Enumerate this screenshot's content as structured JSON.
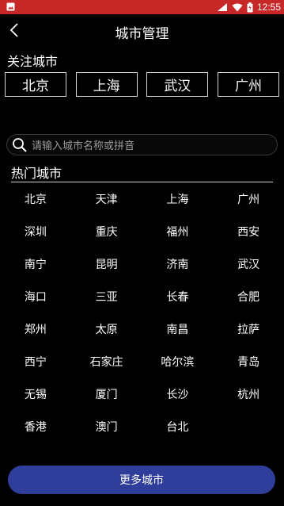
{
  "header": {
    "title": "城市管理"
  },
  "followed": {
    "label": "关注城市",
    "cities": [
      "北京",
      "上海",
      "武汉",
      "广州"
    ]
  },
  "search": {
    "placeholder": "请输入城市名称或拼音"
  },
  "hot": {
    "label": "热门城市",
    "rows": [
      [
        "北京",
        "天津",
        "上海",
        "广州"
      ],
      [
        "深圳",
        "重庆",
        "福州",
        "西安"
      ],
      [
        "南宁",
        "昆明",
        "济南",
        "武汉"
      ],
      [
        "海口",
        "三亚",
        "长春",
        "合肥"
      ],
      [
        "郑州",
        "太原",
        "南昌",
        "拉萨"
      ],
      [
        "西宁",
        "石家庄",
        "哈尔滨",
        "青岛"
      ],
      [
        "无锡",
        "厦门",
        "长沙",
        "杭州"
      ],
      [
        "香港",
        "澳门",
        "台北",
        ""
      ]
    ]
  },
  "footer": {
    "more_label": "更多城市"
  },
  "status": {
    "time": "12:55"
  },
  "colors": {
    "status_bar": "#c62828",
    "button": "#2f3d9b",
    "background": "#000000"
  }
}
